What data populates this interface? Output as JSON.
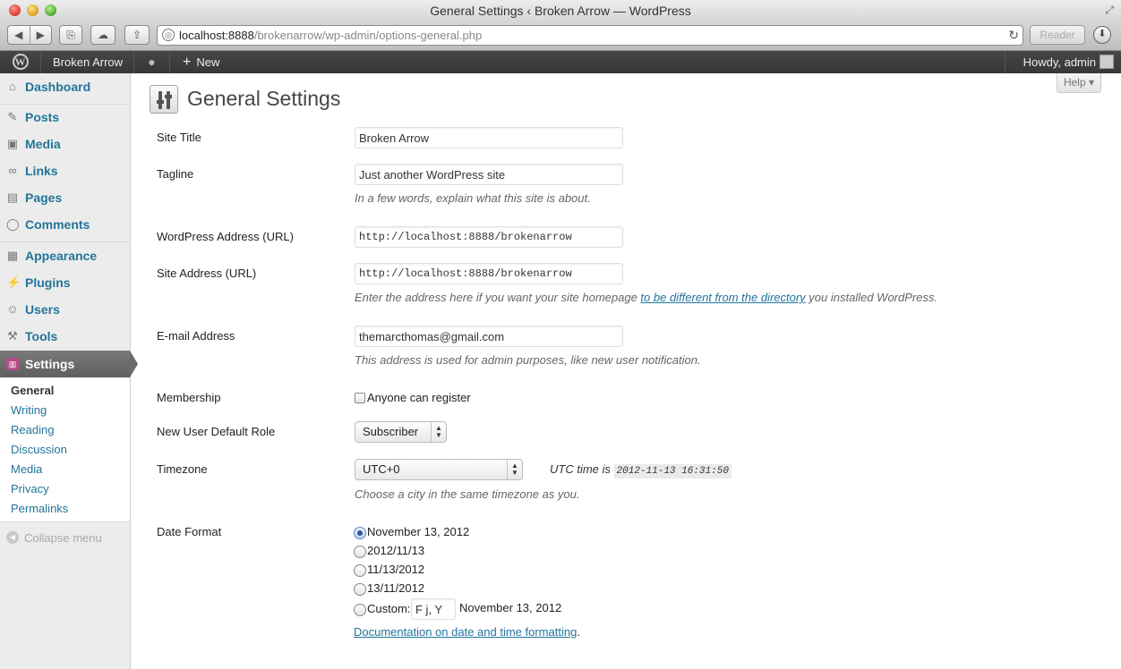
{
  "window": {
    "title": "General Settings ‹ Broken Arrow — WordPress"
  },
  "browser": {
    "url_host": "localhost:8888",
    "url_path": "/brokenarrow/wp-admin/options-general.php",
    "reader_label": "Reader"
  },
  "adminbar": {
    "site_name": "Broken Arrow",
    "new_label": "New",
    "howdy": "Howdy, admin"
  },
  "sidebar": {
    "menu": [
      {
        "label": "Dashboard",
        "icon": "home-icon"
      },
      {
        "label": "Posts",
        "icon": "pushpin-icon"
      },
      {
        "label": "Media",
        "icon": "media-icon"
      },
      {
        "label": "Links",
        "icon": "link-icon"
      },
      {
        "label": "Pages",
        "icon": "pages-icon"
      },
      {
        "label": "Comments",
        "icon": "comment-icon"
      },
      {
        "label": "Appearance",
        "icon": "appearance-icon"
      },
      {
        "label": "Plugins",
        "icon": "plugin-icon"
      },
      {
        "label": "Users",
        "icon": "users-icon"
      },
      {
        "label": "Tools",
        "icon": "tools-icon"
      },
      {
        "label": "Settings",
        "icon": "settings-icon"
      }
    ],
    "submenu": [
      "General",
      "Writing",
      "Reading",
      "Discussion",
      "Media",
      "Privacy",
      "Permalinks"
    ],
    "collapse_label": "Collapse menu"
  },
  "page": {
    "title": "General Settings",
    "help_label": "Help ▾"
  },
  "form": {
    "site_title": {
      "label": "Site Title",
      "value": "Broken Arrow"
    },
    "tagline": {
      "label": "Tagline",
      "value": "Just another WordPress site",
      "description": "In a few words, explain what this site is about."
    },
    "wp_address": {
      "label": "WordPress Address (URL)",
      "value": "http://localhost:8888/brokenarrow"
    },
    "site_address": {
      "label": "Site Address (URL)",
      "value": "http://localhost:8888/brokenarrow",
      "desc_before": "Enter the address here if you want your site homepage ",
      "desc_link": "to be different from the directory",
      "desc_after": " you installed WordPress."
    },
    "email": {
      "label": "E-mail Address",
      "value": "themarcthomas@gmail.com",
      "description": "This address is used for admin purposes, like new user notification."
    },
    "membership": {
      "label": "Membership",
      "checkbox_label": "Anyone can register",
      "checked": false
    },
    "default_role": {
      "label": "New User Default Role",
      "value": "Subscriber"
    },
    "timezone": {
      "label": "Timezone",
      "value": "UTC+0",
      "utc_prefix": "UTC time is",
      "utc_time": "2012-11-13 16:31:50",
      "description": "Choose a city in the same timezone as you."
    },
    "date_format": {
      "label": "Date Format",
      "options": [
        "November 13, 2012",
        "2012/11/13",
        "11/13/2012",
        "13/11/2012"
      ],
      "selected_index": 0,
      "custom_label": "Custom:",
      "custom_value": "F j, Y",
      "custom_preview": "November 13, 2012",
      "doc_link": "Documentation on date and time formatting",
      "doc_suffix": "."
    }
  }
}
